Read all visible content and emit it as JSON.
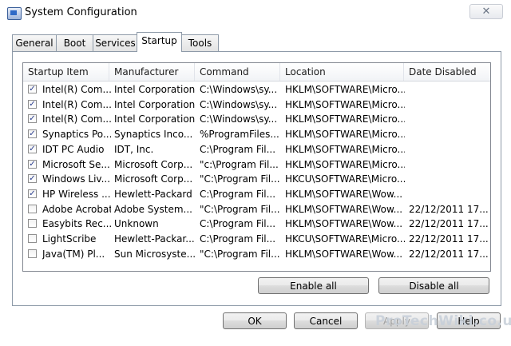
{
  "window": {
    "title": "System Configuration",
    "close_glyph": "✕"
  },
  "tabs": [
    {
      "label": "General"
    },
    {
      "label": "Boot"
    },
    {
      "label": "Services"
    },
    {
      "label": "Startup"
    },
    {
      "label": "Tools"
    }
  ],
  "active_tab": "Startup",
  "list": {
    "columns": [
      "Startup Item",
      "Manufacturer",
      "Command",
      "Location",
      "Date Disabled"
    ],
    "rows": [
      {
        "checked": true,
        "item": "Intel(R) Com...",
        "manufacturer": "Intel Corporation",
        "command": "C:\\Windows\\sy...",
        "location": "HKLM\\SOFTWARE\\Micro...",
        "date": ""
      },
      {
        "checked": true,
        "item": "Intel(R) Com...",
        "manufacturer": "Intel Corporation",
        "command": "C:\\Windows\\sy...",
        "location": "HKLM\\SOFTWARE\\Micro...",
        "date": ""
      },
      {
        "checked": true,
        "item": "Intel(R) Com...",
        "manufacturer": "Intel Corporation",
        "command": "C:\\Windows\\sy...",
        "location": "HKLM\\SOFTWARE\\Micro...",
        "date": ""
      },
      {
        "checked": true,
        "item": "Synaptics Po...",
        "manufacturer": "Synaptics Inco...",
        "command": "%ProgramFiles...",
        "location": "HKLM\\SOFTWARE\\Micro...",
        "date": ""
      },
      {
        "checked": true,
        "item": "IDT PC Audio",
        "manufacturer": "IDT, Inc.",
        "command": "C:\\Program Fil...",
        "location": "HKLM\\SOFTWARE\\Micro...",
        "date": ""
      },
      {
        "checked": true,
        "item": "Microsoft Se...",
        "manufacturer": "Microsoft Corp...",
        "command": "\"c:\\Program Fil...",
        "location": "HKLM\\SOFTWARE\\Micro...",
        "date": ""
      },
      {
        "checked": true,
        "item": "Windows Liv...",
        "manufacturer": "Microsoft Corp...",
        "command": "\"C:\\Program Fil...",
        "location": "HKCU\\SOFTWARE\\Micro...",
        "date": ""
      },
      {
        "checked": true,
        "item": "HP Wireless ...",
        "manufacturer": "Hewlett-Packard",
        "command": "C:\\Program Fil...",
        "location": "HKLM\\SOFTWARE\\Wow...",
        "date": ""
      },
      {
        "checked": false,
        "item": "Adobe Acrobat",
        "manufacturer": "Adobe System...",
        "command": "\"C:\\Program Fil...",
        "location": "HKLM\\SOFTWARE\\Wow...",
        "date": "22/12/2011 17..."
      },
      {
        "checked": false,
        "item": "Easybits Rec...",
        "manufacturer": "Unknown",
        "command": "C:\\Program Fil...",
        "location": "HKLM\\SOFTWARE\\Wow...",
        "date": "22/12/2011 17..."
      },
      {
        "checked": false,
        "item": "LightScribe",
        "manufacturer": "Hewlett-Packar...",
        "command": "C:\\Program Fil...",
        "location": "HKCU\\SOFTWARE\\Micro...",
        "date": "22/12/2011 17..."
      },
      {
        "checked": false,
        "item": "Java(TM) Pl...",
        "manufacturer": "Sun Microsyste...",
        "command": "\"C:\\Program Fil...",
        "location": "HKLM\\SOFTWARE\\Wow...",
        "date": "22/12/2011 17..."
      }
    ]
  },
  "buttons": {
    "enable_all": "Enable all",
    "disable_all": "Disable all",
    "ok": "OK",
    "cancel": "Cancel",
    "apply": "Apply",
    "help": "Help"
  },
  "watermark": "ProTechWiki.co.uk",
  "colors": {
    "check": "#2a3d8f",
    "border": "#828790"
  }
}
